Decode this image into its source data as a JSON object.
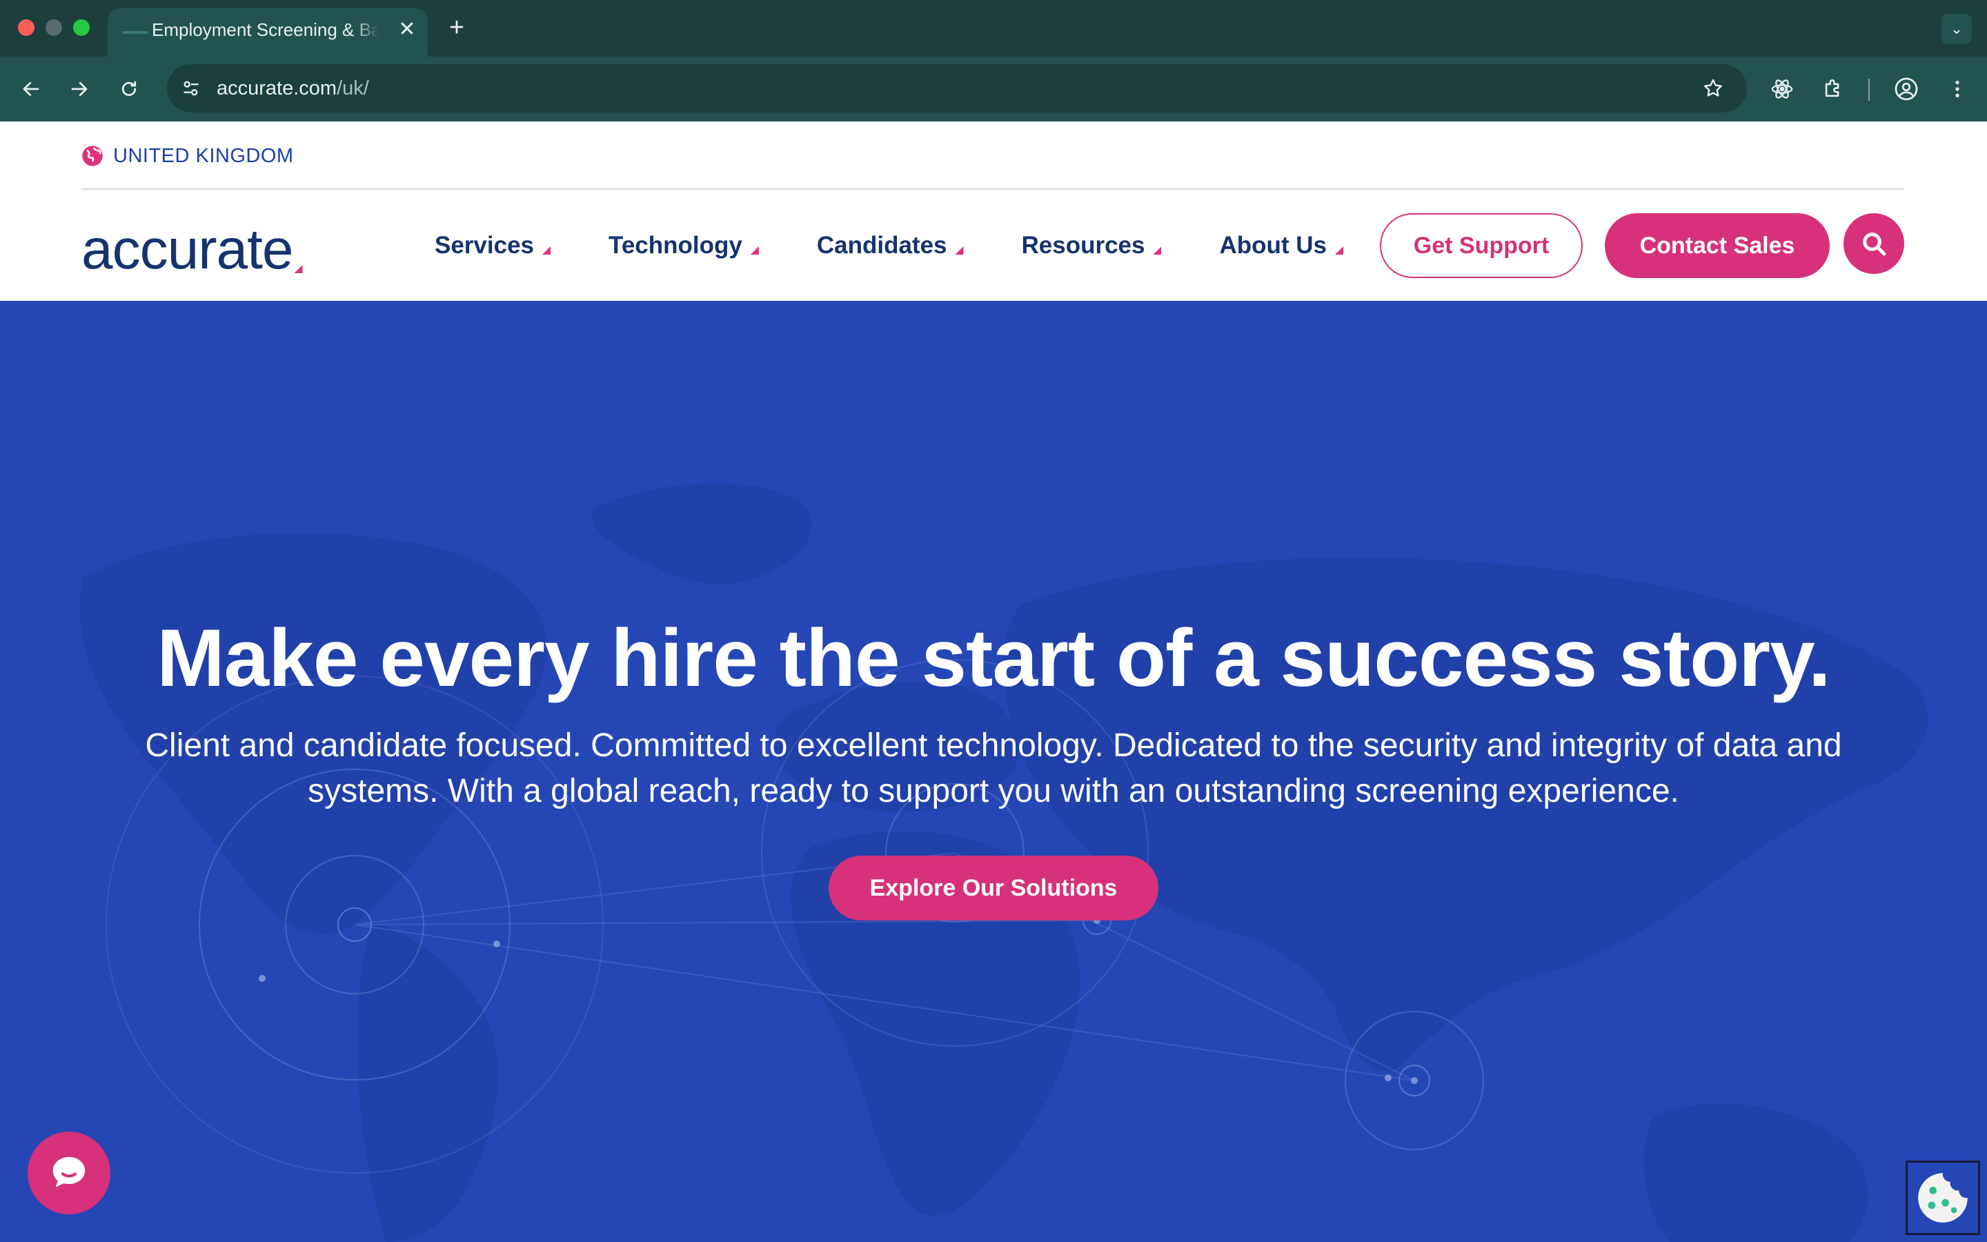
{
  "browser": {
    "tab_title": "Employment Screening & Background Checks",
    "tab_close": "✕",
    "new_tab": "+",
    "tab_menu": "⌄",
    "url_host": "accurate.com",
    "url_path": "/uk/"
  },
  "header": {
    "region_label": "UNITED KINGDOM",
    "logo_text": "accurate",
    "nav": [
      {
        "label": "Services"
      },
      {
        "label": "Technology"
      },
      {
        "label": "Candidates"
      },
      {
        "label": "Resources"
      },
      {
        "label": "About Us"
      }
    ],
    "support_label": "Get Support",
    "sales_label": "Contact Sales"
  },
  "hero": {
    "title": "Make every hire the start of a success story.",
    "subtitle": "Client and candidate focused. Committed to excellent technology. Dedicated to the security and integrity of data and systems. With a global reach, ready to support you with an outstanding screening experience.",
    "cta_label": "Explore Our Solutions"
  },
  "colors": {
    "brand_navy": "#15336f",
    "brand_pink": "#d6317a",
    "hero_blue": "#2547b5"
  }
}
